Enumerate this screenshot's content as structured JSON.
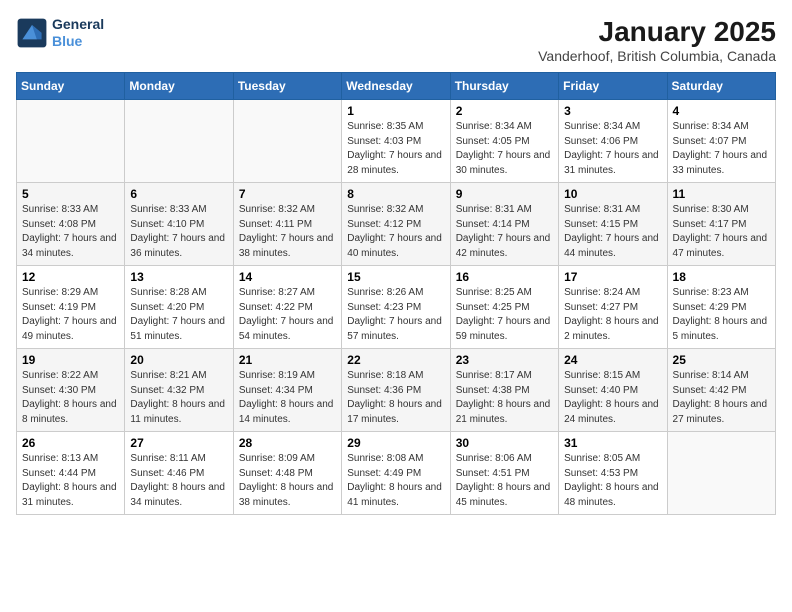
{
  "header": {
    "logo_line1": "General",
    "logo_line2": "Blue",
    "title": "January 2025",
    "subtitle": "Vanderhoof, British Columbia, Canada"
  },
  "days_of_week": [
    "Sunday",
    "Monday",
    "Tuesday",
    "Wednesday",
    "Thursday",
    "Friday",
    "Saturday"
  ],
  "weeks": [
    [
      {
        "day": "",
        "sunrise": "",
        "sunset": "",
        "daylight": ""
      },
      {
        "day": "",
        "sunrise": "",
        "sunset": "",
        "daylight": ""
      },
      {
        "day": "",
        "sunrise": "",
        "sunset": "",
        "daylight": ""
      },
      {
        "day": "1",
        "sunrise": "Sunrise: 8:35 AM",
        "sunset": "Sunset: 4:03 PM",
        "daylight": "Daylight: 7 hours and 28 minutes."
      },
      {
        "day": "2",
        "sunrise": "Sunrise: 8:34 AM",
        "sunset": "Sunset: 4:05 PM",
        "daylight": "Daylight: 7 hours and 30 minutes."
      },
      {
        "day": "3",
        "sunrise": "Sunrise: 8:34 AM",
        "sunset": "Sunset: 4:06 PM",
        "daylight": "Daylight: 7 hours and 31 minutes."
      },
      {
        "day": "4",
        "sunrise": "Sunrise: 8:34 AM",
        "sunset": "Sunset: 4:07 PM",
        "daylight": "Daylight: 7 hours and 33 minutes."
      }
    ],
    [
      {
        "day": "5",
        "sunrise": "Sunrise: 8:33 AM",
        "sunset": "Sunset: 4:08 PM",
        "daylight": "Daylight: 7 hours and 34 minutes."
      },
      {
        "day": "6",
        "sunrise": "Sunrise: 8:33 AM",
        "sunset": "Sunset: 4:10 PM",
        "daylight": "Daylight: 7 hours and 36 minutes."
      },
      {
        "day": "7",
        "sunrise": "Sunrise: 8:32 AM",
        "sunset": "Sunset: 4:11 PM",
        "daylight": "Daylight: 7 hours and 38 minutes."
      },
      {
        "day": "8",
        "sunrise": "Sunrise: 8:32 AM",
        "sunset": "Sunset: 4:12 PM",
        "daylight": "Daylight: 7 hours and 40 minutes."
      },
      {
        "day": "9",
        "sunrise": "Sunrise: 8:31 AM",
        "sunset": "Sunset: 4:14 PM",
        "daylight": "Daylight: 7 hours and 42 minutes."
      },
      {
        "day": "10",
        "sunrise": "Sunrise: 8:31 AM",
        "sunset": "Sunset: 4:15 PM",
        "daylight": "Daylight: 7 hours and 44 minutes."
      },
      {
        "day": "11",
        "sunrise": "Sunrise: 8:30 AM",
        "sunset": "Sunset: 4:17 PM",
        "daylight": "Daylight: 7 hours and 47 minutes."
      }
    ],
    [
      {
        "day": "12",
        "sunrise": "Sunrise: 8:29 AM",
        "sunset": "Sunset: 4:19 PM",
        "daylight": "Daylight: 7 hours and 49 minutes."
      },
      {
        "day": "13",
        "sunrise": "Sunrise: 8:28 AM",
        "sunset": "Sunset: 4:20 PM",
        "daylight": "Daylight: 7 hours and 51 minutes."
      },
      {
        "day": "14",
        "sunrise": "Sunrise: 8:27 AM",
        "sunset": "Sunset: 4:22 PM",
        "daylight": "Daylight: 7 hours and 54 minutes."
      },
      {
        "day": "15",
        "sunrise": "Sunrise: 8:26 AM",
        "sunset": "Sunset: 4:23 PM",
        "daylight": "Daylight: 7 hours and 57 minutes."
      },
      {
        "day": "16",
        "sunrise": "Sunrise: 8:25 AM",
        "sunset": "Sunset: 4:25 PM",
        "daylight": "Daylight: 7 hours and 59 minutes."
      },
      {
        "day": "17",
        "sunrise": "Sunrise: 8:24 AM",
        "sunset": "Sunset: 4:27 PM",
        "daylight": "Daylight: 8 hours and 2 minutes."
      },
      {
        "day": "18",
        "sunrise": "Sunrise: 8:23 AM",
        "sunset": "Sunset: 4:29 PM",
        "daylight": "Daylight: 8 hours and 5 minutes."
      }
    ],
    [
      {
        "day": "19",
        "sunrise": "Sunrise: 8:22 AM",
        "sunset": "Sunset: 4:30 PM",
        "daylight": "Daylight: 8 hours and 8 minutes."
      },
      {
        "day": "20",
        "sunrise": "Sunrise: 8:21 AM",
        "sunset": "Sunset: 4:32 PM",
        "daylight": "Daylight: 8 hours and 11 minutes."
      },
      {
        "day": "21",
        "sunrise": "Sunrise: 8:19 AM",
        "sunset": "Sunset: 4:34 PM",
        "daylight": "Daylight: 8 hours and 14 minutes."
      },
      {
        "day": "22",
        "sunrise": "Sunrise: 8:18 AM",
        "sunset": "Sunset: 4:36 PM",
        "daylight": "Daylight: 8 hours and 17 minutes."
      },
      {
        "day": "23",
        "sunrise": "Sunrise: 8:17 AM",
        "sunset": "Sunset: 4:38 PM",
        "daylight": "Daylight: 8 hours and 21 minutes."
      },
      {
        "day": "24",
        "sunrise": "Sunrise: 8:15 AM",
        "sunset": "Sunset: 4:40 PM",
        "daylight": "Daylight: 8 hours and 24 minutes."
      },
      {
        "day": "25",
        "sunrise": "Sunrise: 8:14 AM",
        "sunset": "Sunset: 4:42 PM",
        "daylight": "Daylight: 8 hours and 27 minutes."
      }
    ],
    [
      {
        "day": "26",
        "sunrise": "Sunrise: 8:13 AM",
        "sunset": "Sunset: 4:44 PM",
        "daylight": "Daylight: 8 hours and 31 minutes."
      },
      {
        "day": "27",
        "sunrise": "Sunrise: 8:11 AM",
        "sunset": "Sunset: 4:46 PM",
        "daylight": "Daylight: 8 hours and 34 minutes."
      },
      {
        "day": "28",
        "sunrise": "Sunrise: 8:09 AM",
        "sunset": "Sunset: 4:48 PM",
        "daylight": "Daylight: 8 hours and 38 minutes."
      },
      {
        "day": "29",
        "sunrise": "Sunrise: 8:08 AM",
        "sunset": "Sunset: 4:49 PM",
        "daylight": "Daylight: 8 hours and 41 minutes."
      },
      {
        "day": "30",
        "sunrise": "Sunrise: 8:06 AM",
        "sunset": "Sunset: 4:51 PM",
        "daylight": "Daylight: 8 hours and 45 minutes."
      },
      {
        "day": "31",
        "sunrise": "Sunrise: 8:05 AM",
        "sunset": "Sunset: 4:53 PM",
        "daylight": "Daylight: 8 hours and 48 minutes."
      },
      {
        "day": "",
        "sunrise": "",
        "sunset": "",
        "daylight": ""
      }
    ]
  ]
}
